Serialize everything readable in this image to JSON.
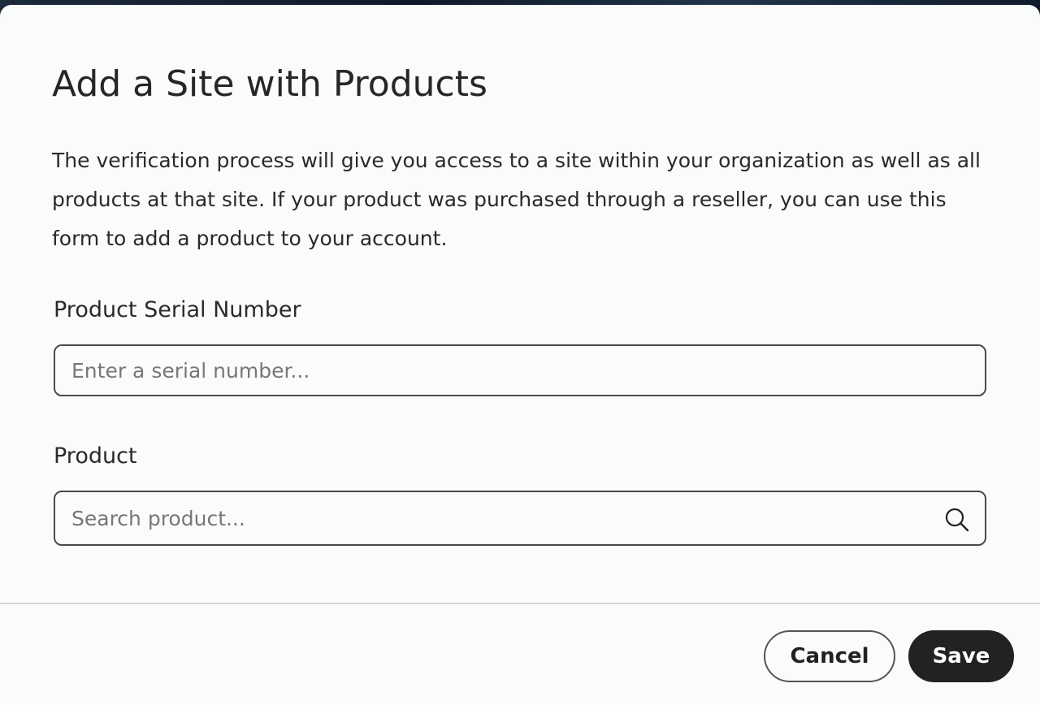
{
  "dialog": {
    "title": "Add a Site with Products",
    "description": "The verification process will give you access to a site within your organization as well as all products at that site. If your product was purchased through a reseller, you can use this form to add a product to your account."
  },
  "form": {
    "serial": {
      "label": "Product Serial Number",
      "placeholder": "Enter a serial number...",
      "value": ""
    },
    "product": {
      "label": "Product",
      "placeholder": "Search product...",
      "value": "",
      "icon": "search-icon"
    }
  },
  "footer": {
    "cancel_label": "Cancel",
    "save_label": "Save"
  }
}
